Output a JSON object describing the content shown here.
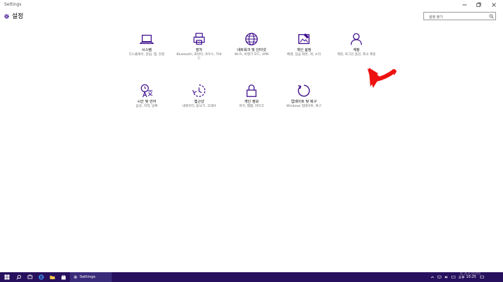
{
  "window": {
    "title": "Settings"
  },
  "header": {
    "title": "설정",
    "icon": "gear-icon"
  },
  "search": {
    "placeholder": "설정 찾기"
  },
  "tiles": [
    {
      "title": "시스템",
      "desc": "디스플레이, 알림, 앱, 전원",
      "icon": "laptop-icon"
    },
    {
      "title": "장치",
      "desc": "Bluetooth, 프린터, 마우스, 키보드",
      "icon": "devices-icon"
    },
    {
      "title": "네트워크 및 인터넷",
      "desc": "Wi-Fi, 비행기 모드, VPN",
      "icon": "globe-icon"
    },
    {
      "title": "개인 설정",
      "desc": "배경, 잠금 화면, 색, 소리",
      "icon": "personalization-icon"
    },
    {
      "title": "계정",
      "desc": "계정, 로그인 옵션, 회사 계정",
      "icon": "person-icon"
    },
    {
      "title": "시간 및 언어",
      "desc": "음성, 지역, 날짜",
      "icon": "time-language-icon"
    },
    {
      "title": "접근성",
      "desc": "내레이터, 돋보기, 고대비",
      "icon": "ease-of-access-icon"
    },
    {
      "title": "개인 정보",
      "desc": "위치, 웹캠, 마이크",
      "icon": "lock-icon"
    },
    {
      "title": "업데이트 및 복구",
      "desc": "Windows 업데이트, 복구",
      "icon": "refresh-icon"
    }
  ],
  "taskbar": {
    "active_app": "Settings",
    "clock": "10:25",
    "ampm": "오후"
  },
  "watermark": "EXcom",
  "colors": {
    "accent": "#3d0d8c",
    "taskbar": "#27105e",
    "arrow": "#ee1111"
  }
}
